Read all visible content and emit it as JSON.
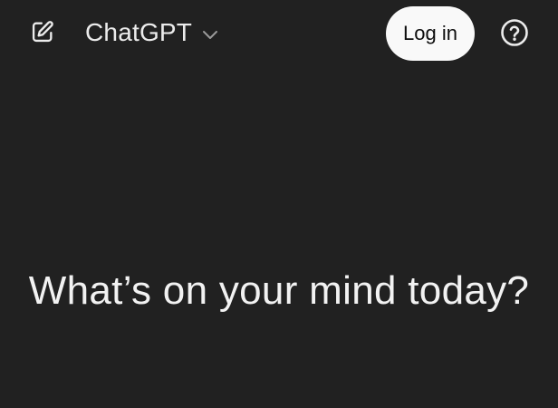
{
  "header": {
    "new_chat_icon": "edit-icon",
    "model_name": "ChatGPT",
    "model_chevron_icon": "chevron-down-icon",
    "login_label": "Log in",
    "help_icon": "question-circle-icon"
  },
  "main": {
    "headline": "What’s on your mind today?"
  },
  "colors": {
    "background": "#212121",
    "text": "#ececec",
    "login_button_bg": "#f9f9f9",
    "login_button_text": "#0d0d0d"
  }
}
